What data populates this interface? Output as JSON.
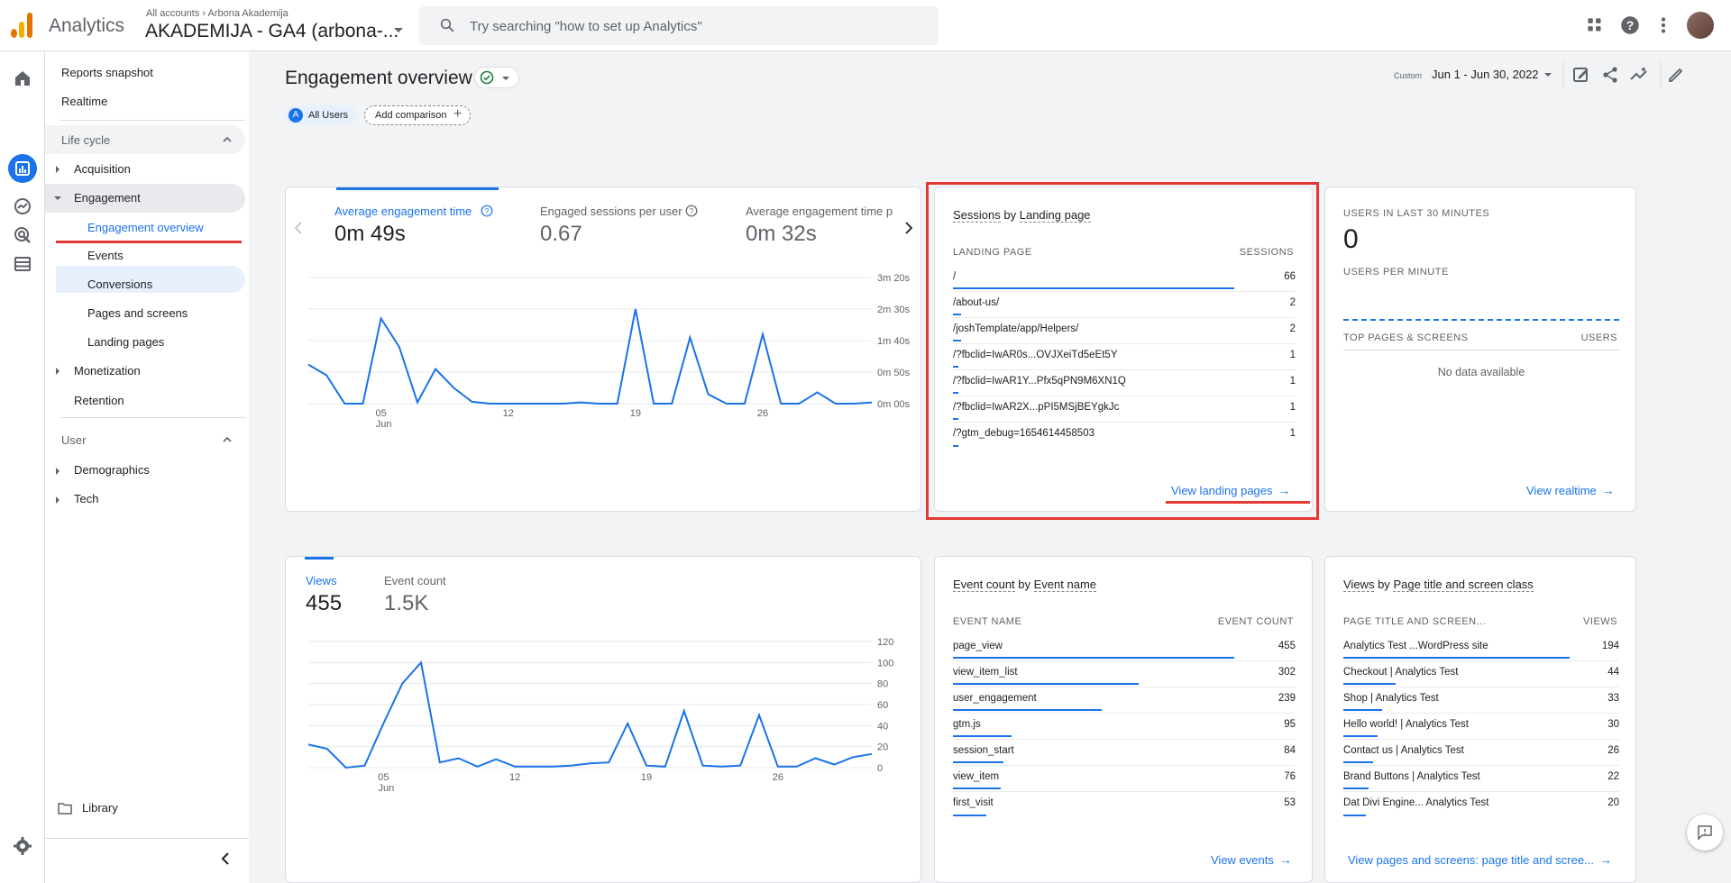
{
  "app": {
    "name": "Analytics"
  },
  "account": {
    "breadcrumb_all": "All accounts",
    "breadcrumb_sep": "›",
    "breadcrumb_org": "Arbona Akademija",
    "property": "AKADEMIJA - GA4 (arbona-..."
  },
  "search": {
    "placeholder": "Try searching \"how to set up Analytics\""
  },
  "sidebar": {
    "reports_snapshot": "Reports snapshot",
    "realtime": "Realtime",
    "lifecycle": "Life cycle",
    "acquisition": "Acquisition",
    "engagement": "Engagement",
    "engagement_sub": [
      "Engagement overview",
      "Events",
      "Conversions",
      "Pages and screens",
      "Landing pages"
    ],
    "monetization": "Monetization",
    "retention": "Retention",
    "user": "User",
    "demographics": "Demographics",
    "tech": "Tech",
    "library": "Library"
  },
  "header": {
    "title": "Engagement overview",
    "chip_users_letter": "A",
    "chip_users": "All Users",
    "add_comparison": "Add comparison",
    "date_custom": "Custom",
    "date_range": "Jun 1 - Jun 30, 2022"
  },
  "engagement_card": {
    "metrics": [
      {
        "label": "Average engagement time",
        "value": "0m 49s"
      },
      {
        "label": "Engaged sessions per user",
        "value": "0.67"
      },
      {
        "label": "Average engagement time p",
        "value": "0m 32s"
      }
    ],
    "y_ticks": [
      "3m 20s",
      "2m 30s",
      "1m 40s",
      "0m 50s",
      "0m 00s"
    ],
    "x_ticks": [
      "05",
      "12",
      "19",
      "26"
    ],
    "x_sub": "Jun"
  },
  "views_card": {
    "metrics": [
      {
        "label": "Views",
        "value": "455"
      },
      {
        "label": "Event count",
        "value": "1.5K"
      }
    ],
    "y_ticks": [
      "120",
      "100",
      "80",
      "60",
      "40",
      "20",
      "0"
    ],
    "x_ticks": [
      "05",
      "12",
      "19",
      "26"
    ],
    "x_sub": "Jun"
  },
  "chart_data": [
    {
      "type": "line",
      "title": "Average engagement time",
      "x": [
        1,
        2,
        3,
        4,
        5,
        6,
        7,
        8,
        9,
        10,
        11,
        12,
        13,
        14,
        15,
        16,
        17,
        18,
        19,
        20,
        21,
        22,
        23,
        24,
        25,
        26,
        27,
        28,
        29,
        30
      ],
      "values_seconds": [
        62,
        45,
        0,
        0,
        135,
        90,
        2,
        55,
        25,
        3,
        0,
        0,
        0,
        0,
        0,
        2,
        0,
        0,
        150,
        0,
        0,
        105,
        15,
        0,
        0,
        110,
        0,
        0,
        18,
        0,
        0,
        2
      ],
      "ylim": [
        0,
        200
      ],
      "ylabel_ticks": [
        "0m 00s",
        "0m 50s",
        "1m 40s",
        "2m 30s",
        "3m 20s"
      ]
    },
    {
      "type": "line",
      "title": "Views",
      "x": [
        1,
        2,
        3,
        4,
        5,
        6,
        7,
        8,
        9,
        10,
        11,
        12,
        13,
        14,
        15,
        16,
        17,
        18,
        19,
        20,
        21,
        22,
        23,
        24,
        25,
        26,
        27,
        28,
        29,
        30
      ],
      "values": [
        22,
        18,
        0,
        2,
        42,
        80,
        100,
        5,
        9,
        1,
        8,
        1,
        1,
        1,
        2,
        4,
        5,
        42,
        2,
        1,
        54,
        2,
        1,
        2,
        50,
        1,
        1,
        9,
        3,
        10,
        13
      ],
      "ylim": [
        0,
        120
      ]
    }
  ],
  "landing_card": {
    "title_a": "Sessions",
    "title_by": "by",
    "title_b": "Landing page",
    "col1": "LANDING PAGE",
    "col2": "SESSIONS",
    "rows": [
      {
        "label": "/",
        "value": "66",
        "frac": 1.0
      },
      {
        "label": "/about-us/",
        "value": "2",
        "frac": 0.03
      },
      {
        "label": "/joshTemplate/app/Helpers/",
        "value": "2",
        "frac": 0.03
      },
      {
        "label": "/?fbclid=IwAR0s...OVJXeiTd5eEt5Y",
        "value": "1",
        "frac": 0.015
      },
      {
        "label": "/?fbclid=IwAR1Y...Pfx5qPN9M6XN1Q",
        "value": "1",
        "frac": 0.015
      },
      {
        "label": "/?fbclid=IwAR2X...pPI5MSjBEYgkJc",
        "value": "1",
        "frac": 0.015
      },
      {
        "label": "/?gtm_debug=1654614458503",
        "value": "1",
        "frac": 0.015
      }
    ],
    "link": "View landing pages"
  },
  "realtime_card": {
    "users_30": "USERS IN LAST 30 MINUTES",
    "users_value": "0",
    "per_minute": "USERS PER MINUTE",
    "col1": "TOP PAGES & SCREENS",
    "col2": "USERS",
    "empty": "No data available",
    "link": "View realtime"
  },
  "events_card": {
    "title_a": "Event count",
    "title_by": "by",
    "title_b": "Event name",
    "col1": "EVENT NAME",
    "col2": "EVENT COUNT",
    "rows": [
      {
        "label": "page_view",
        "value": "455",
        "frac": 1.0
      },
      {
        "label": "view_item_list",
        "value": "302",
        "frac": 0.66
      },
      {
        "label": "user_engagement",
        "value": "239",
        "frac": 0.53
      },
      {
        "label": "gtm.js",
        "value": "95",
        "frac": 0.21
      },
      {
        "label": "session_start",
        "value": "84",
        "frac": 0.18
      },
      {
        "label": "view_item",
        "value": "76",
        "frac": 0.17
      },
      {
        "label": "first_visit",
        "value": "53",
        "frac": 0.12
      }
    ],
    "link": "View events"
  },
  "pages_card": {
    "title_a": "Views",
    "title_by": "by",
    "title_b": "Page title and screen class",
    "col1": "PAGE TITLE AND SCREEN...",
    "col2": "VIEWS",
    "rows": [
      {
        "label": "Analytics Test ...WordPress site",
        "value": "194",
        "frac": 1.0
      },
      {
        "label": "Checkout | Analytics Test",
        "value": "44",
        "frac": 0.23
      },
      {
        "label": "Shop | Analytics Test",
        "value": "33",
        "frac": 0.17
      },
      {
        "label": "Hello world! | Analytics Test",
        "value": "30",
        "frac": 0.15
      },
      {
        "label": "Contact us | Analytics Test",
        "value": "26",
        "frac": 0.13
      },
      {
        "label": "Brand Buttons | Analytics Test",
        "value": "22",
        "frac": 0.11
      },
      {
        "label": "Dat Divi Engine... Analytics Test",
        "value": "20",
        "frac": 0.1
      }
    ],
    "link": "View pages and screens: page title and scree..."
  },
  "colors": {
    "accent": "#1a73e8",
    "highlight": "#e53935"
  }
}
